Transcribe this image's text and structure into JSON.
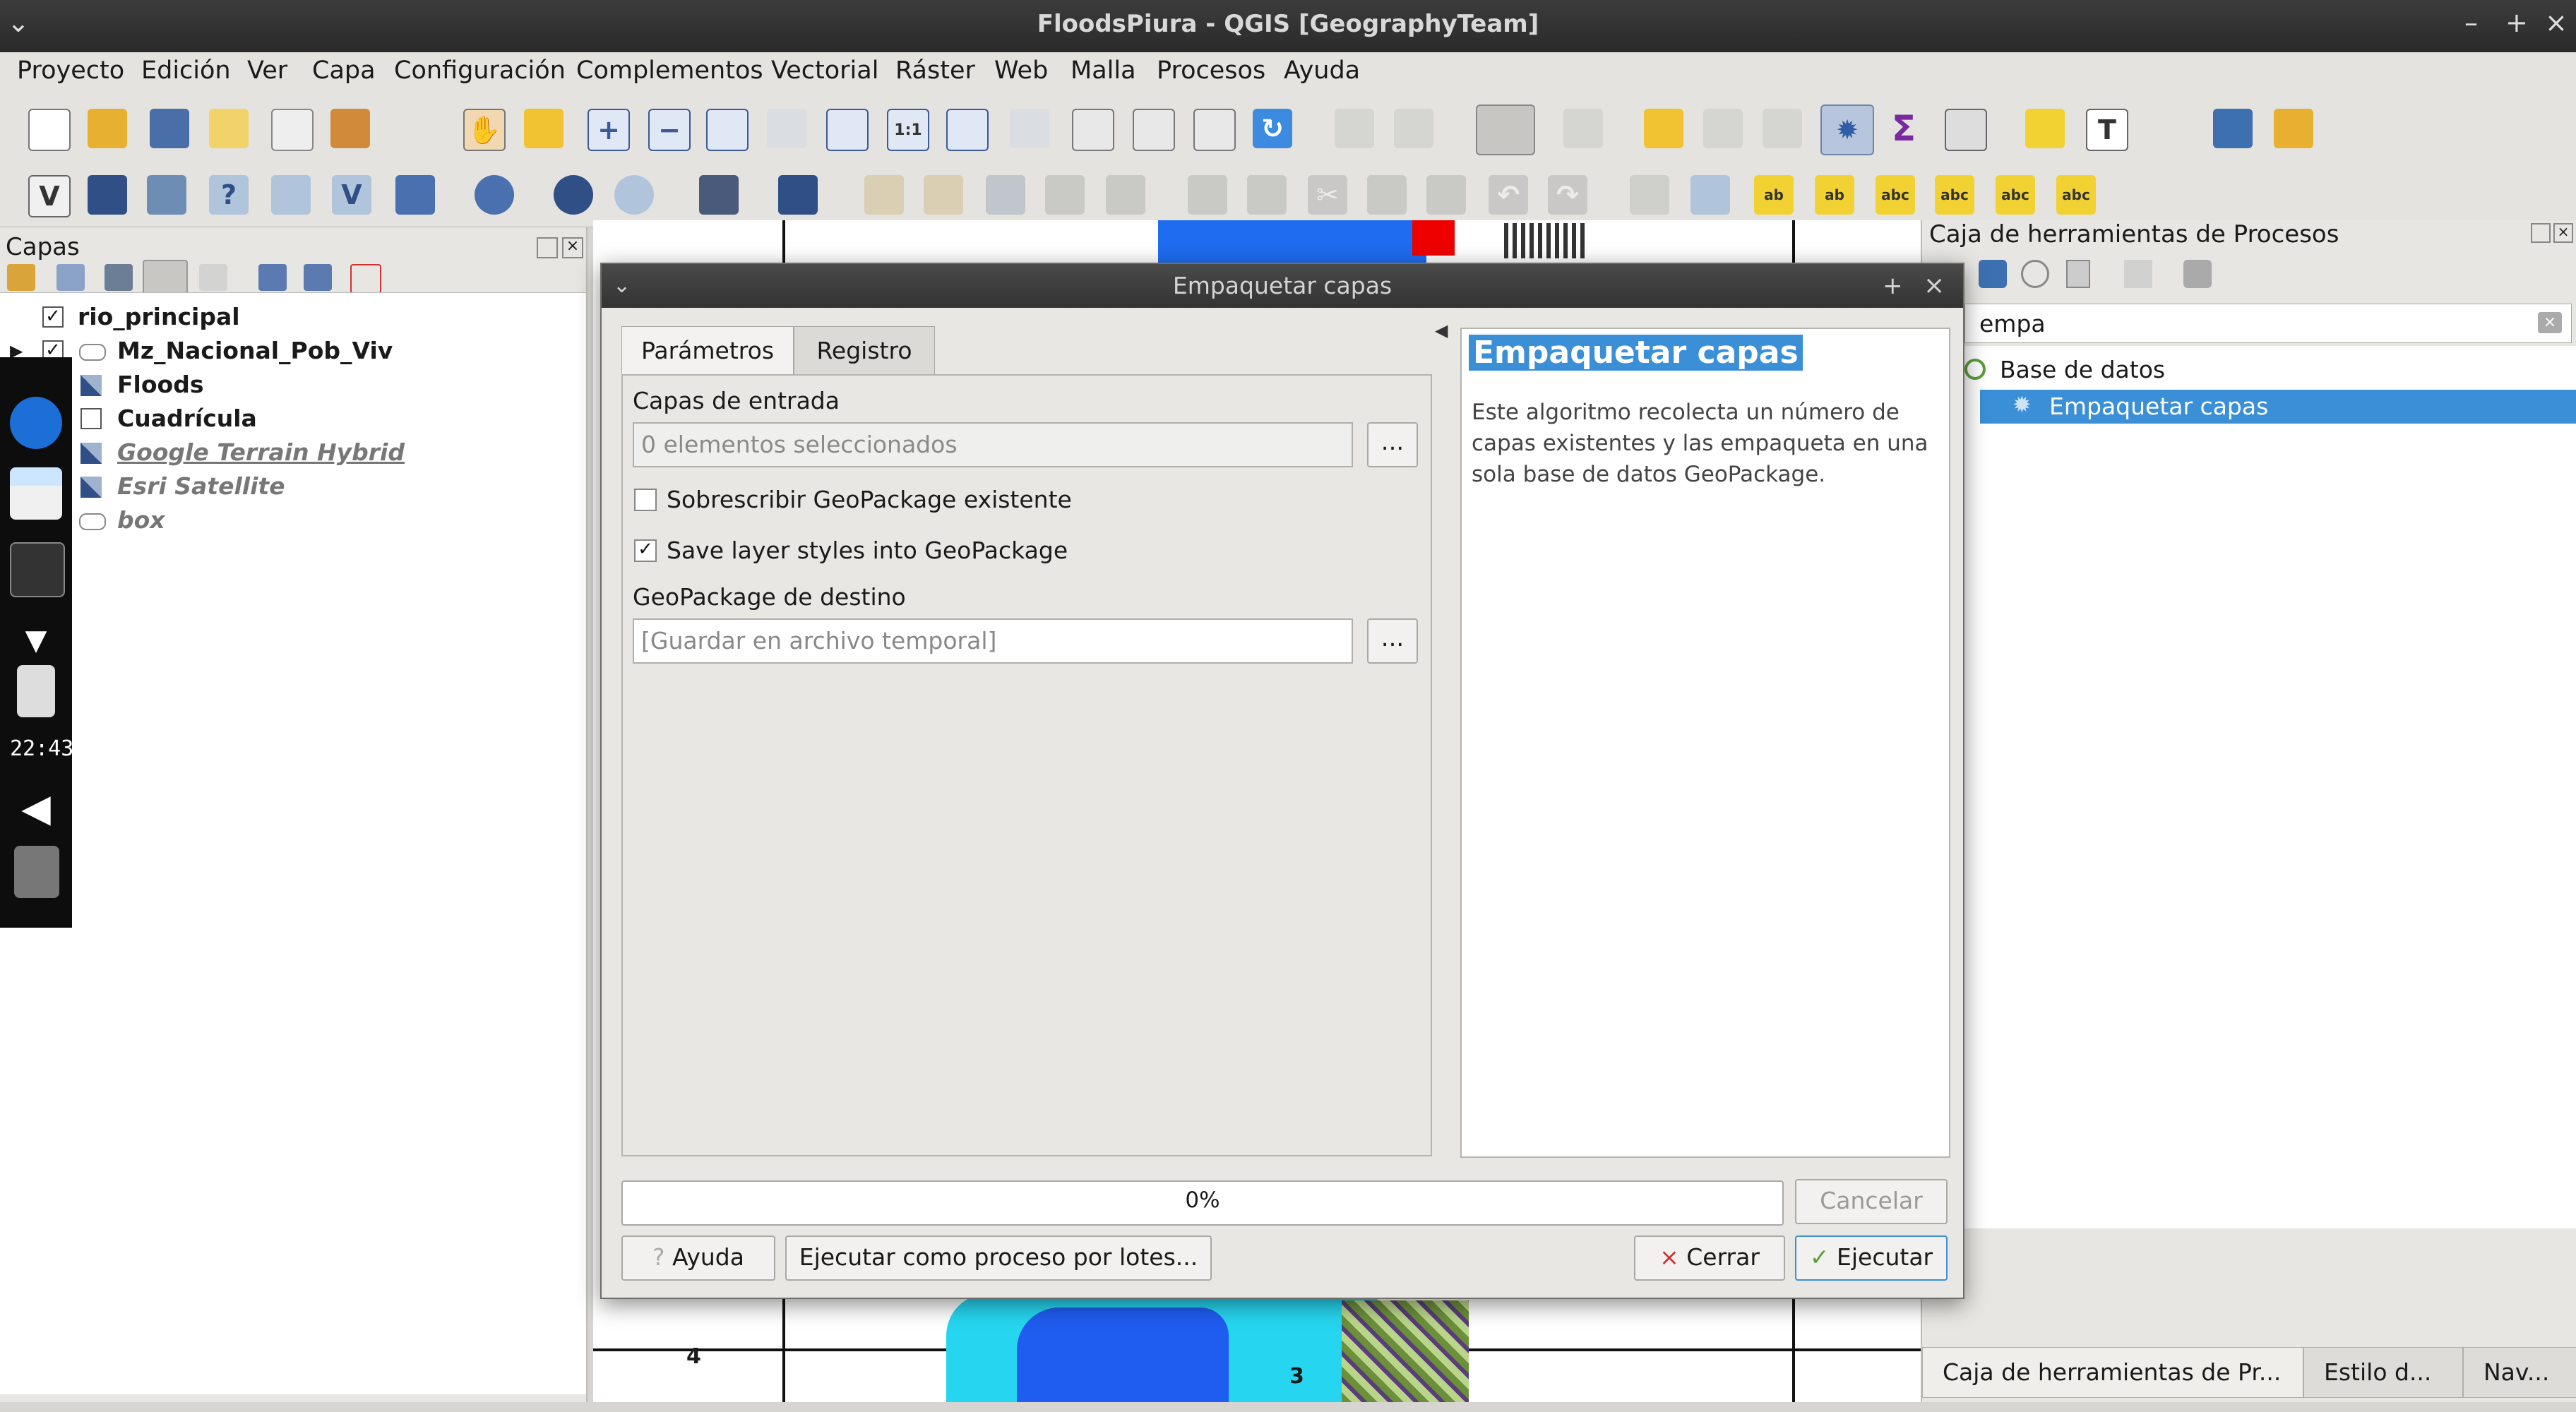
{
  "window": {
    "title": "FloodsPiura - QGIS [GeographyTeam]"
  },
  "menu": {
    "items": [
      "Proyecto",
      "Edición",
      "Ver",
      "Capa",
      "Configuración",
      "Complementos",
      "Vectorial",
      "Ráster",
      "Web",
      "Malla",
      "Procesos",
      "Ayuda"
    ]
  },
  "layers_panel": {
    "title": "Capas",
    "layers": [
      {
        "name": "rio_principal",
        "checked": true
      },
      {
        "name": "Mz_Nacional_Pob_Viv",
        "checked": true
      },
      {
        "name": "Floods",
        "checked": true
      },
      {
        "name": "Cuadrícula",
        "checked": false
      },
      {
        "name": "Google Terrain Hybrid",
        "checked": false
      },
      {
        "name": "Esri Satellite",
        "checked": false
      },
      {
        "name": "box",
        "checked": false
      }
    ]
  },
  "dock": {
    "clock": "22:43"
  },
  "map": {
    "grid_labels": [
      "4",
      "3"
    ]
  },
  "processing": {
    "title": "Caja de herramientas de Procesos",
    "search_value": "empa",
    "group": "Base de datos",
    "selected_tool": "Empaquetar capas",
    "bottom_tabs": [
      "Caja de herramientas de Pr...",
      "Estilo d...",
      "Nav..."
    ]
  },
  "dialog": {
    "title": "Empaquetar capas",
    "tabs": [
      "Parámetros",
      "Registro"
    ],
    "input_label": "Capas de entrada",
    "input_value": "0 elementos seleccionados",
    "dots": "...",
    "overwrite_label": "Sobrescribir GeoPackage existente",
    "overwrite_checked": false,
    "save_styles_label": "Save layer styles into GeoPackage",
    "save_styles_checked": true,
    "dest_label": "GeoPackage de destino",
    "dest_placeholder": "[Guardar en archivo temporal]",
    "help_title": "Empaquetar capas",
    "help_text": "Este algoritmo recolecta un número de capas existentes y las empaqueta en una sola base de datos GeoPackage.",
    "progress": "0%",
    "progress_value": 0,
    "cancel_label": "Cancelar",
    "help_button": "Ayuda",
    "batch_button": "Ejecutar como proceso por lotes...",
    "close_button": "Cerrar",
    "run_button": "Ejecutar"
  }
}
